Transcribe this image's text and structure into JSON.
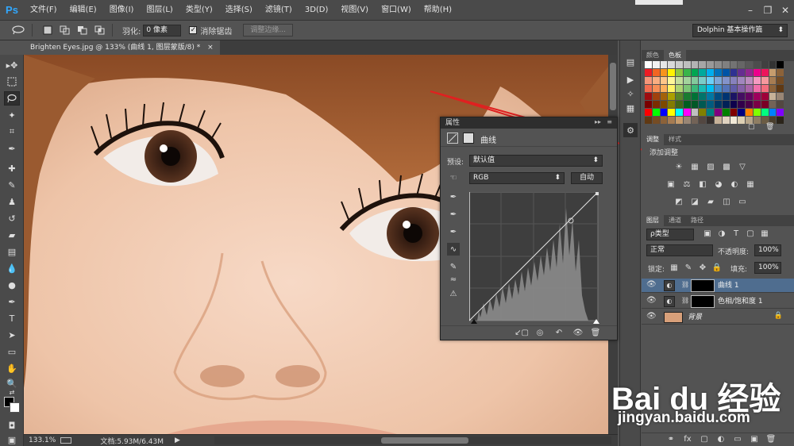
{
  "app": {
    "logo": "Ps"
  },
  "menu": [
    "文件(F)",
    "编辑(E)",
    "图像(I)",
    "图层(L)",
    "类型(Y)",
    "选择(S)",
    "滤镜(T)",
    "3D(D)",
    "视图(V)",
    "窗口(W)",
    "帮助(H)"
  ],
  "window_controls": {
    "minimize": "–",
    "maximize": "❐",
    "close": "✕"
  },
  "options_bar": {
    "feather_label": "羽化:",
    "feather_value": "0 像素",
    "antialias_checked": "✓",
    "antialias_label": "消除锯齿",
    "refine_edge_label": "调整边缘...",
    "workspace": "Dolphin 基本操作篇"
  },
  "document_tab": {
    "label": "Brighten Eyes.jpg @ 133% (曲线 1, 图层蒙版/8) *",
    "close": "×"
  },
  "status": {
    "zoom": "133.1%",
    "doc": "文档:5.93M/6.43M",
    "arrow": "▶"
  },
  "swatches_panel": {
    "tabs": [
      "颜色",
      "色板"
    ],
    "active_tab": 1,
    "colors": [
      [
        "#ffffff",
        "#f2f2f2",
        "#e6e6e6",
        "#d9d9d9",
        "#cccccc",
        "#bfbfbf",
        "#b3b3b3",
        "#a6a6a6",
        "#999999",
        "#8c8c8c",
        "#808080",
        "#737373",
        "#666666",
        "#595959",
        "#4d4d4d",
        "#404040",
        "#333333",
        "#000000"
      ],
      [
        "#ed1c24",
        "#f26522",
        "#f7941d",
        "#fff200",
        "#8dc63f",
        "#39b54a",
        "#00a651",
        "#00a99d",
        "#00aeef",
        "#0072bc",
        "#0054a6",
        "#2e3192",
        "#662d91",
        "#92278f",
        "#ec008c",
        "#ed145b",
        "#c69c6d",
        "#8c6239"
      ],
      [
        "#f69679",
        "#f9ad81",
        "#fdc689",
        "#fff799",
        "#c4df9b",
        "#a3d39c",
        "#82ca9c",
        "#7accc8",
        "#6dcff6",
        "#7da7d9",
        "#8393ca",
        "#8781bd",
        "#a186be",
        "#bd8cbf",
        "#f49ac1",
        "#f5989d",
        "#a67c52",
        "#754c24"
      ],
      [
        "#f26c4f",
        "#f68e56",
        "#fbaf5c",
        "#fff467",
        "#acd372",
        "#7cc576",
        "#3bb878",
        "#1abbb4",
        "#00bff3",
        "#438ccb",
        "#5574b9",
        "#605ca8",
        "#8560a8",
        "#a864a8",
        "#f06eaa",
        "#f26d7d",
        "#8c6239",
        "#603913"
      ],
      [
        "#9e0b0f",
        "#a0410d",
        "#a36209",
        "#aba000",
        "#598527",
        "#1a7b30",
        "#007236",
        "#00746b",
        "#0076a3",
        "#004b80",
        "#003471",
        "#1b1464",
        "#440e62",
        "#630460",
        "#9e005d",
        "#9e0039",
        "#c7b299",
        "#998675"
      ],
      [
        "#790000",
        "#7b2e00",
        "#7d4900",
        "#827b00",
        "#406618",
        "#005e20",
        "#005826",
        "#005952",
        "#005b7f",
        "#003663",
        "#002157",
        "#0d004c",
        "#32004b",
        "#4b0049",
        "#7b0046",
        "#7a0026",
        "#736357",
        "#534741"
      ],
      [
        "#ff0000",
        "#00ff00",
        "#0000ff",
        "#ffff00",
        "#00ffff",
        "#ff00ff",
        "#c0c0c0",
        "#808000",
        "#008080",
        "#800080",
        "#008000",
        "#800000",
        "#000080",
        "#ff8000",
        "#80ff00",
        "#00ff80",
        "#0080ff",
        "#8000ff"
      ],
      [
        "#603913",
        "#754c24",
        "#8c6239",
        "#a67c52",
        "#c69c6d",
        "#998675",
        "#736357",
        "#534741",
        "#362f2d",
        "#c7b299",
        "#e0d3c0",
        "#f2ead8",
        "#ddd0b4",
        "#b7a68a",
        "#8f7e63",
        "#6b5c44",
        "#4a3f2e",
        "#2b241a"
      ]
    ],
    "swatches_label": "色板"
  },
  "adjustments_panel": {
    "tabs": [
      "调整",
      "样式"
    ],
    "active_tab": 0,
    "subtitle": "添加调整",
    "icons_row1": [
      "☀",
      "▦",
      "▨",
      "▩",
      "▽"
    ],
    "icons_row2": [
      "▣",
      "⚖",
      "◧",
      "◕",
      "◐",
      "▦"
    ],
    "icons_row3": [
      "◩",
      "◪",
      "▰",
      "◫",
      "▭"
    ]
  },
  "layers_panel": {
    "tabs": [
      "图层",
      "通道",
      "路径"
    ],
    "active_tab": 0,
    "filter_label": "ρ类型",
    "filter_icons": [
      "▣",
      "◑",
      "T",
      "▢",
      "▦"
    ],
    "blend_mode": "正常",
    "opacity_label": "不透明度:",
    "opacity_value": "100%",
    "lock_label": "锁定:",
    "lock_icons": [
      "▦",
      "✎",
      "✥",
      "🔒"
    ],
    "fill_label": "填充:",
    "fill_value": "100%",
    "layers": [
      {
        "name": "曲线 1",
        "selected": true,
        "type": "adjustment"
      },
      {
        "name": "色相/饱和度 1",
        "selected": false,
        "type": "adjustment"
      },
      {
        "name": "背景",
        "selected": false,
        "type": "image"
      }
    ],
    "footer_icons": [
      "⚭",
      "fx",
      "▢",
      "◐",
      "▭",
      "▣",
      "🗑"
    ]
  },
  "properties_panel": {
    "title": "属性",
    "header_label": "曲线",
    "preset_label": "预设:",
    "preset_value": "默认值",
    "channel_value": "RGB",
    "auto_label": "自动",
    "footer_icons": [
      "↙▢",
      "◎",
      "↶",
      "👁",
      "🗑"
    ]
  },
  "watermark": {
    "brand": "Bai du 经验",
    "url": "jingyan.baidu.com"
  }
}
